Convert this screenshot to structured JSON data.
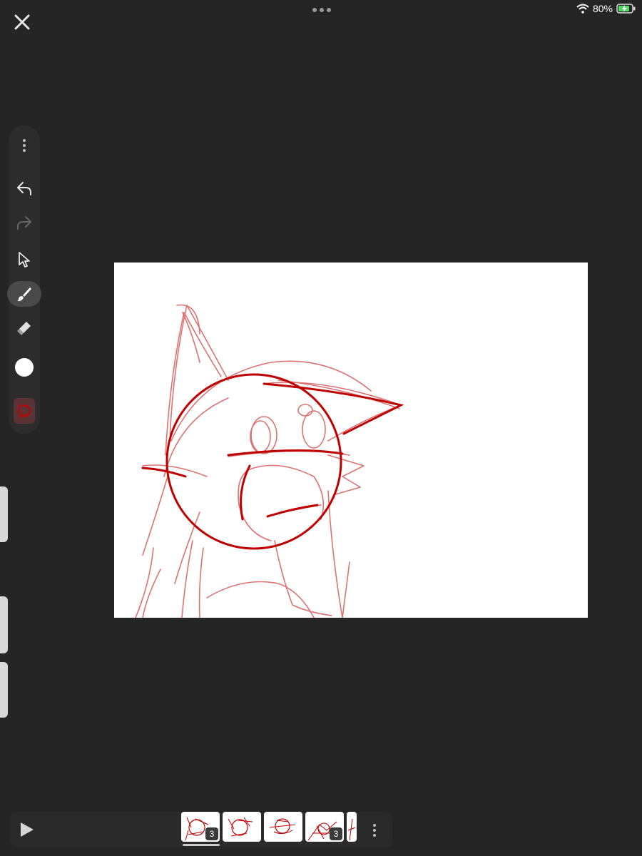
{
  "status": {
    "battery_percent": "80%",
    "wifi_icon": "wifi-icon",
    "battery_icon": "battery-charging-icon",
    "battery_color": "#4cd964"
  },
  "window": {
    "close_icon": "close-icon",
    "more_icon": "more-dots-icon"
  },
  "toolbar": {
    "items": [
      "more-vertical-icon",
      "undo-icon",
      "redo-icon",
      "select-arrow-icon",
      "brush-icon",
      "eraser-icon",
      "color-swatch",
      "layer-thumbnail"
    ],
    "active_tool": "brush",
    "current_color": "#ffffff"
  },
  "canvas": {
    "background": "#ffffff",
    "stroke_color": "#c00000"
  },
  "timeline": {
    "play_icon": "play-icon",
    "frames": [
      {
        "badge": "3"
      },
      {
        "badge": ""
      },
      {
        "badge": ""
      },
      {
        "badge": "3"
      },
      {
        "badge": ""
      }
    ],
    "menu_icon": "more-vertical-icon"
  }
}
